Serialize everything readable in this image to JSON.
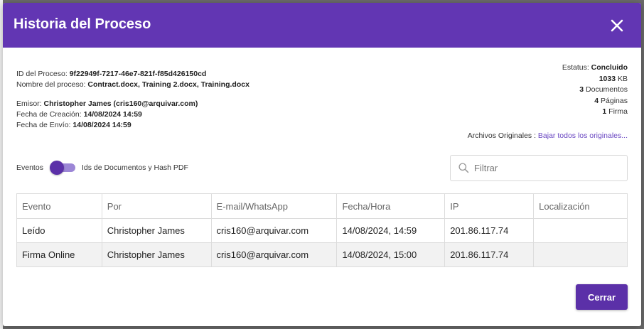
{
  "modal": {
    "title": "Historia del Proceso",
    "close_label": "×"
  },
  "process": {
    "id_label": "ID del Proceso:",
    "id_value": "9f22949f-7217-46e7-821f-f85d426150cd",
    "name_label": "Nombre del proceso:",
    "name_value": "Contract.docx, Training 2.docx, Training.docx",
    "emitter_label": "Emisor:",
    "emitter_value": "Christopher James (cris160@arquivar.com)",
    "created_label": "Fecha de Creación:",
    "created_value": "14/08/2024 14:59",
    "sent_label": "Fecha de Envío:",
    "sent_value": "14/08/2024 14:59"
  },
  "summary": {
    "status_label": "Estatus:",
    "status_value": "Concluido",
    "size_value": "1033",
    "size_unit": "KB",
    "documents_value": "3",
    "documents_label": "Documentos",
    "pages_value": "4",
    "pages_label": "Páginas",
    "signatures_value": "1",
    "signatures_label": "Firma"
  },
  "originals": {
    "label": "Archivos Originales :",
    "link": "Bajar todos los originales..."
  },
  "toggle": {
    "left_label": "Eventos",
    "right_label": "Ids de Documentos y Hash PDF",
    "state": "on"
  },
  "filter": {
    "placeholder": "Filtrar",
    "value": ""
  },
  "table": {
    "columns": [
      "Evento",
      "Por",
      "E-mail/WhatsApp",
      "Fecha/Hora",
      "IP",
      "Localización"
    ],
    "rows": [
      [
        "Leído",
        "Christopher James",
        "cris160@arquivar.com",
        "14/08/2024, 14:59",
        "201.86.117.74",
        ""
      ],
      [
        "Firma Online",
        "Christopher James",
        "cris160@arquivar.com",
        "14/08/2024, 15:00",
        "201.86.117.74",
        ""
      ]
    ]
  },
  "footer": {
    "close_button": "Cerrar"
  },
  "colors": {
    "header_bg": "#6236b3",
    "primary_button": "#5b30a8",
    "link": "#6a47c2",
    "toggle_track": "#9c86d6",
    "row_alt": "#f2f2f2"
  }
}
